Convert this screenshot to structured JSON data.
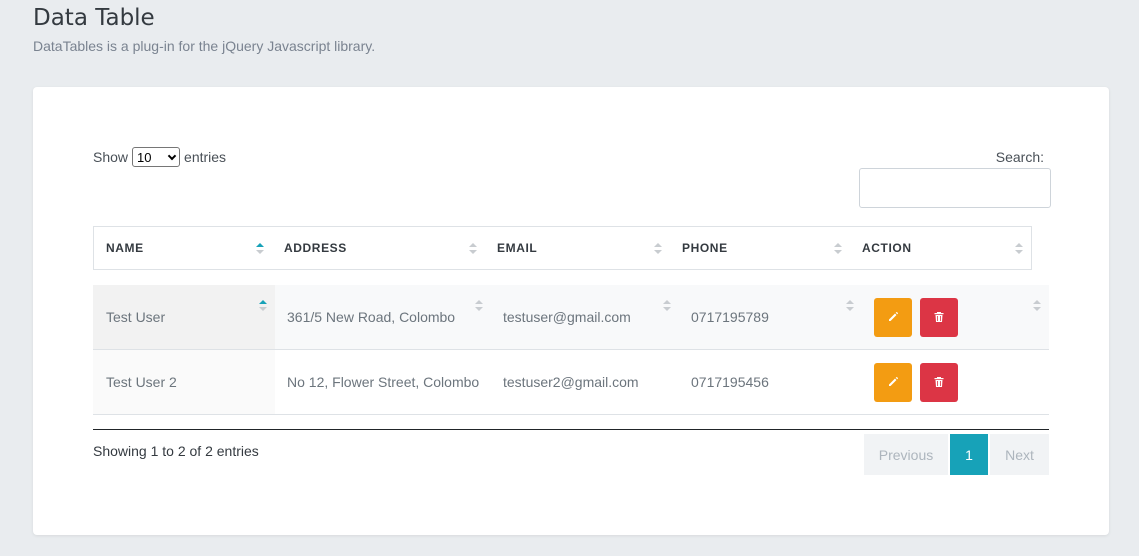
{
  "page": {
    "title": "Data Table",
    "subtitle": "DataTables is a plug-in for the jQuery Javascript library."
  },
  "controls": {
    "show_label": "Show",
    "entries_label": "entries",
    "page_length": "10",
    "search_label": "Search:",
    "search_value": ""
  },
  "table": {
    "columns": [
      {
        "label": "NAME",
        "sorted": "asc"
      },
      {
        "label": "ADDRESS",
        "sorted": "none"
      },
      {
        "label": "EMAIL",
        "sorted": "none"
      },
      {
        "label": "PHONE",
        "sorted": "none"
      },
      {
        "label": "ACTION",
        "sorted": "none"
      }
    ],
    "rows": [
      {
        "name": "Test User",
        "address": "361/5 New Road, Colombo",
        "email": "testuser@gmail.com",
        "phone": "0717195789"
      },
      {
        "name": "Test User 2",
        "address": "No 12, Flower Street, Colombo",
        "email": "testuser2@gmail.com",
        "phone": "0717195456"
      }
    ]
  },
  "footer": {
    "info": "Showing 1 to 2 of 2 entries",
    "previous": "Previous",
    "current_page": "1",
    "next": "Next"
  },
  "colors": {
    "edit": "#f39c12",
    "delete": "#dc3545",
    "accent": "#17a2b8"
  },
  "icons": {
    "edit": "pencil-icon",
    "delete": "trash-icon"
  }
}
